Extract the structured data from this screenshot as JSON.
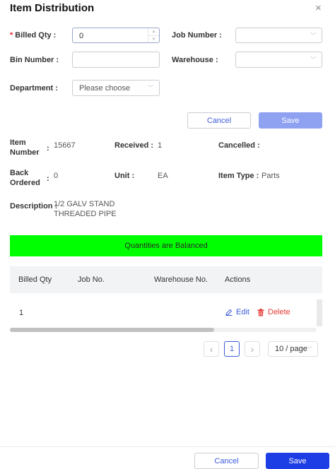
{
  "dialog": {
    "title": "Item Distribution",
    "close_glyph": "×"
  },
  "form": {
    "billed_qty_label": "Billed Qty :",
    "billed_qty_value": "0",
    "job_number_label": "Job Number :",
    "bin_number_label": "Bin Number :",
    "warehouse_label": "Warehouse :",
    "department_label": "Department :",
    "department_placeholder": "Please choose",
    "required_mark": "*",
    "cancel_label": "Cancel",
    "save_label": "Save"
  },
  "details": {
    "item_number_label_1": "Item",
    "item_number_label_2": "Number",
    "item_number_sep": ":",
    "item_number_value": "15667",
    "received_label": "Received :",
    "received_value": "1",
    "cancelled_label": "Cancelled :",
    "back_ordered_label_1": "Back",
    "back_ordered_label_2": "Ordered",
    "back_ordered_sep": ":",
    "back_ordered_value": "0",
    "unit_label": "Unit :",
    "unit_value": "EA",
    "item_type_label": "Item Type :",
    "item_type_value": "Parts",
    "description_label": "Description :",
    "description_line_1": "1/2 GALV STAND",
    "description_line_2": "THREADED PIPE"
  },
  "banner": {
    "text": "Quantities are Balanced",
    "color": "#00ff00"
  },
  "table": {
    "columns": [
      "Billed Qty",
      "Job No.",
      "Warehouse No.",
      "Actions"
    ],
    "rows": [
      {
        "billed_qty": "1",
        "job_no": "",
        "warehouse_no": "",
        "edit_label": "Edit",
        "delete_label": "Delete"
      }
    ]
  },
  "pagination": {
    "prev": "‹",
    "current_page": "1",
    "next": "›",
    "page_size": "10 / page"
  },
  "footer": {
    "cancel_label": "Cancel",
    "save_label": "Save"
  },
  "colors": {
    "primary": "#1d3de5",
    "primary_disabled": "#8fa2f2",
    "danger": "#e53935",
    "required": "#f5222d"
  }
}
